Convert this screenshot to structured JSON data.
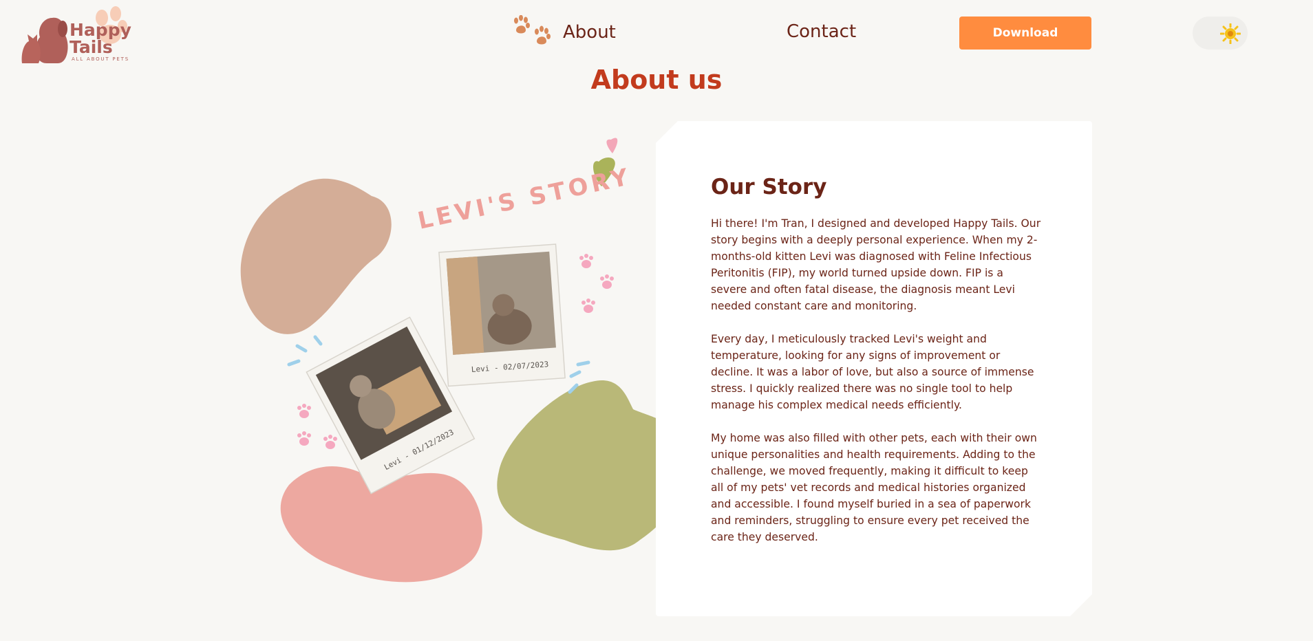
{
  "brand": {
    "name_line1": "Happy",
    "name_line2": "Tails",
    "tagline": "ALL ABOUT PETS"
  },
  "nav": {
    "about": "About",
    "contact": "Contact",
    "download": "Download"
  },
  "page": {
    "title": "About us"
  },
  "illustration": {
    "heading": "LEVI'S STORY",
    "photo1_caption": "Levi - 02/07/2023",
    "photo2_caption": "Levi - 01/12/2023"
  },
  "story": {
    "heading": "Our Story",
    "paragraphs": [
      "Hi there! I'm Tran, I designed and developed Happy Tails. Our story begins with a deeply personal experience. When my 2-months-old kitten Levi was diagnosed with Feline Infectious Peritonitis (FIP), my world turned upside down. FIP is a severe and often fatal disease, the diagnosis meant Levi needed constant care and monitoring.",
      "Every day, I meticulously tracked Levi's weight and temperature, looking for any signs of improvement or decline. It was a labor of love, but also a source of immense stress. I quickly realized there was no single tool to help manage his complex medical needs efficiently.",
      "My home was also filled with other pets, each with their own unique personalities and health requirements. Adding to the challenge, we moved frequently, making it difficult to keep all of my pets' vet records and medical histories organized and accessible. I found myself buried in a sea of paperwork and reminders, struggling to ensure every pet received the care they deserved."
    ]
  },
  "colors": {
    "accent": "#ff8c3f",
    "title": "#c23b1d",
    "text": "#6b2417",
    "blob_tan": "#d4ad97",
    "blob_pink": "#eda8a0",
    "blob_olive": "#b9b878"
  },
  "icons": {
    "nav_about": "paw-prints-icon",
    "theme": "sun-icon"
  }
}
